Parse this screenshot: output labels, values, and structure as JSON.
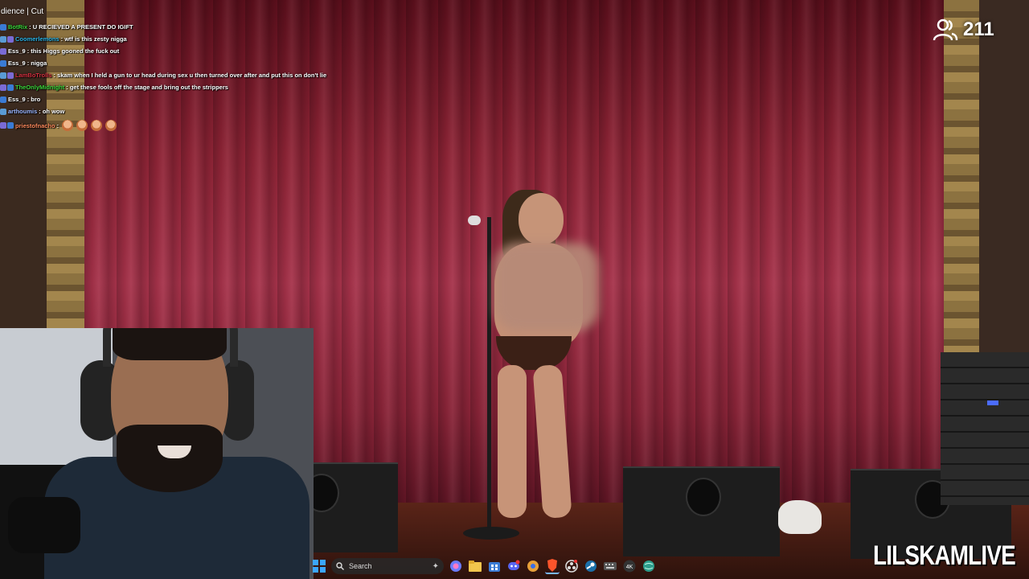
{
  "overlay": {
    "title_fragment": "dience | Cut",
    "viewer_count": "211",
    "brand": "LILSKAMLIVE"
  },
  "chat": {
    "messages": [
      {
        "user": "BotRix",
        "user_color": "#3ad43a",
        "text": ": U RECIEVED A PRESENT DO IGIFT"
      },
      {
        "user": "Coomerlemons",
        "user_color": "#2ab3e6",
        "text": ": wtf is this zesty nigga"
      },
      {
        "user": "Ess_9",
        "user_color": "#ffffff",
        "text": ": this Higgs gooned the fuck out"
      },
      {
        "user": "Ess_9",
        "user_color": "#ffffff",
        "text": ": nigga"
      },
      {
        "user": "LamBoTrolls",
        "user_color": "#d3303f",
        "text": ": skam when I held a gun to ur head during sex u then turned over after and put this on don't lie"
      },
      {
        "user": "TheOnlyMidnight",
        "user_color": "#3ad43a",
        "text": ": get these fools off the stage and bring out the strippers"
      },
      {
        "user": "Ess_9",
        "user_color": "#ffffff",
        "text": ": bro"
      },
      {
        "user": "arthoumis",
        "user_color": "#9bb6ff",
        "text": ": oh wow"
      },
      {
        "user": "priestofnacho",
        "user_color": "#ff8a5c",
        "text": ":"
      }
    ]
  },
  "taskbar": {
    "search_placeholder": "Search",
    "icons": [
      "windows-start-icon",
      "copilot-icon",
      "file-explorer-icon",
      "store-icon",
      "discord-icon",
      "brave-icon",
      "brave-icon-alt",
      "obs-icon",
      "steam-icon",
      "keyboard-icon",
      "4k-icon",
      "globe-icon"
    ]
  },
  "colors": {
    "curtain": "#8f2436",
    "chat_text": "#ffffff"
  }
}
